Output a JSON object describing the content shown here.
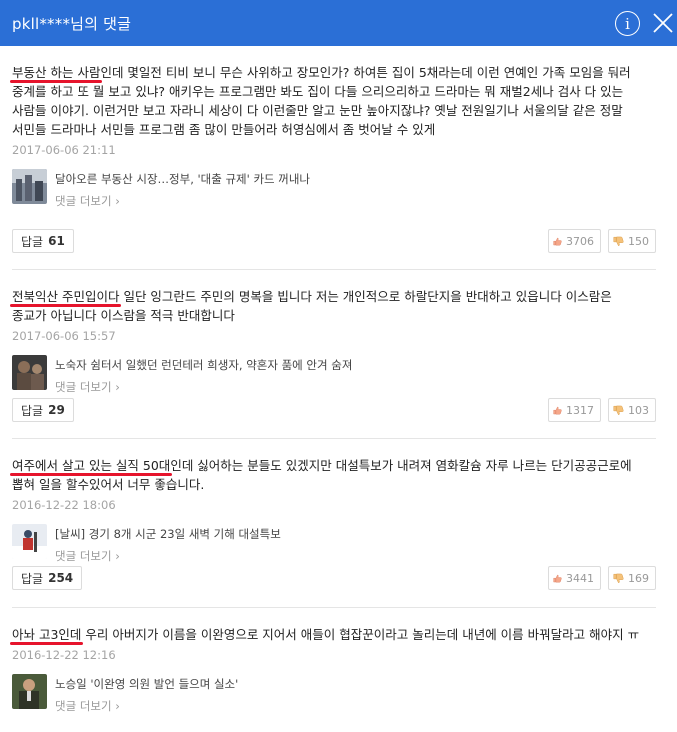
{
  "header": {
    "title": "pkll****님의 댓글",
    "info_label": "i"
  },
  "comments": [
    {
      "highlight": "부동산 하는 사람",
      "text": "인데 몇일전 티비 보니 무슨 사위하고 장모인가? 하여튼 집이 5채라는데 이런 연예인 가족 모임을 둬러 중계를 하고 또 뭘 보고 있냐? 애키우는 프로그램만 봐도 집이 다들 으리으리하고 드라마는 뭐 재벌2세나 검사 다 있는 사람들 이야기. 이런거만 보고 자라니 세상이 다 이런줄만 알고 눈만 높아지잖냐? 옛날 전원일기나 서울의달 같은 정말 서민들 드라마나 서민들 프로그램 좀 많이 만들어라 허영심에서 좀 벗어날 수 있게",
      "date": "2017-06-06 21:11",
      "article_title": "달아오른 부동산 시장…정부, '대출 규제' 카드 꺼내나",
      "more_label": "댓글 더보기",
      "reply_label": "답글",
      "reply_count": "61",
      "likes": "3706",
      "dislikes": "150"
    },
    {
      "highlight": "전북익산 주민입이다",
      "text": " 일단 잉그란드 주민의 명복을 빕니다 저는 개인적으로 하랄단지을 반대하고 있읍니다 이스람은 종교가 아닙니다 이스람을 적극 반대합니다",
      "date": "2017-06-06 15:57",
      "article_title": "노숙자 쉼터서 일했던 런던테러 희생자, 약혼자 품에 안겨 숨져",
      "more_label": "댓글 더보기",
      "reply_label": "답글",
      "reply_count": "29",
      "likes": "1317",
      "dislikes": "103"
    },
    {
      "highlight": "여주에서 살고 있는 실직 50대",
      "text": "인데 싫어하는 분들도 있겠지만 대설특보가 내려져 염화칼슘 자루 나르는 단기공공근로에 뽑혀 일을 할수있어서 너무 좋습니다.",
      "date": "2016-12-22 18:06",
      "article_title": "[날씨] 경기 8개 시군 23일 새벽 기해 대설특보",
      "more_label": "댓글 더보기",
      "reply_label": "답글",
      "reply_count": "254",
      "likes": "3441",
      "dislikes": "169"
    },
    {
      "highlight": "아놔 고3인데",
      "text": " 우리 아버지가 이름을 이완영으로 지어서 애들이 협잡꾼이라고 놀리는데 내년에 이름 바꿔달라고 해야지 ㅠ",
      "date": "2016-12-22 12:16",
      "article_title": "노승일 '이완영 의원 발언 들으며 실소'",
      "more_label": "댓글 더보기"
    }
  ],
  "colors": {
    "header_bg": "#2b6fd6",
    "highlight_underline": "#e6142c",
    "date": "#a4a4a4"
  },
  "icons": [
    "info-icon",
    "close-icon",
    "thumbs-up-icon",
    "thumbs-down-icon",
    "chevron-right-icon"
  ]
}
